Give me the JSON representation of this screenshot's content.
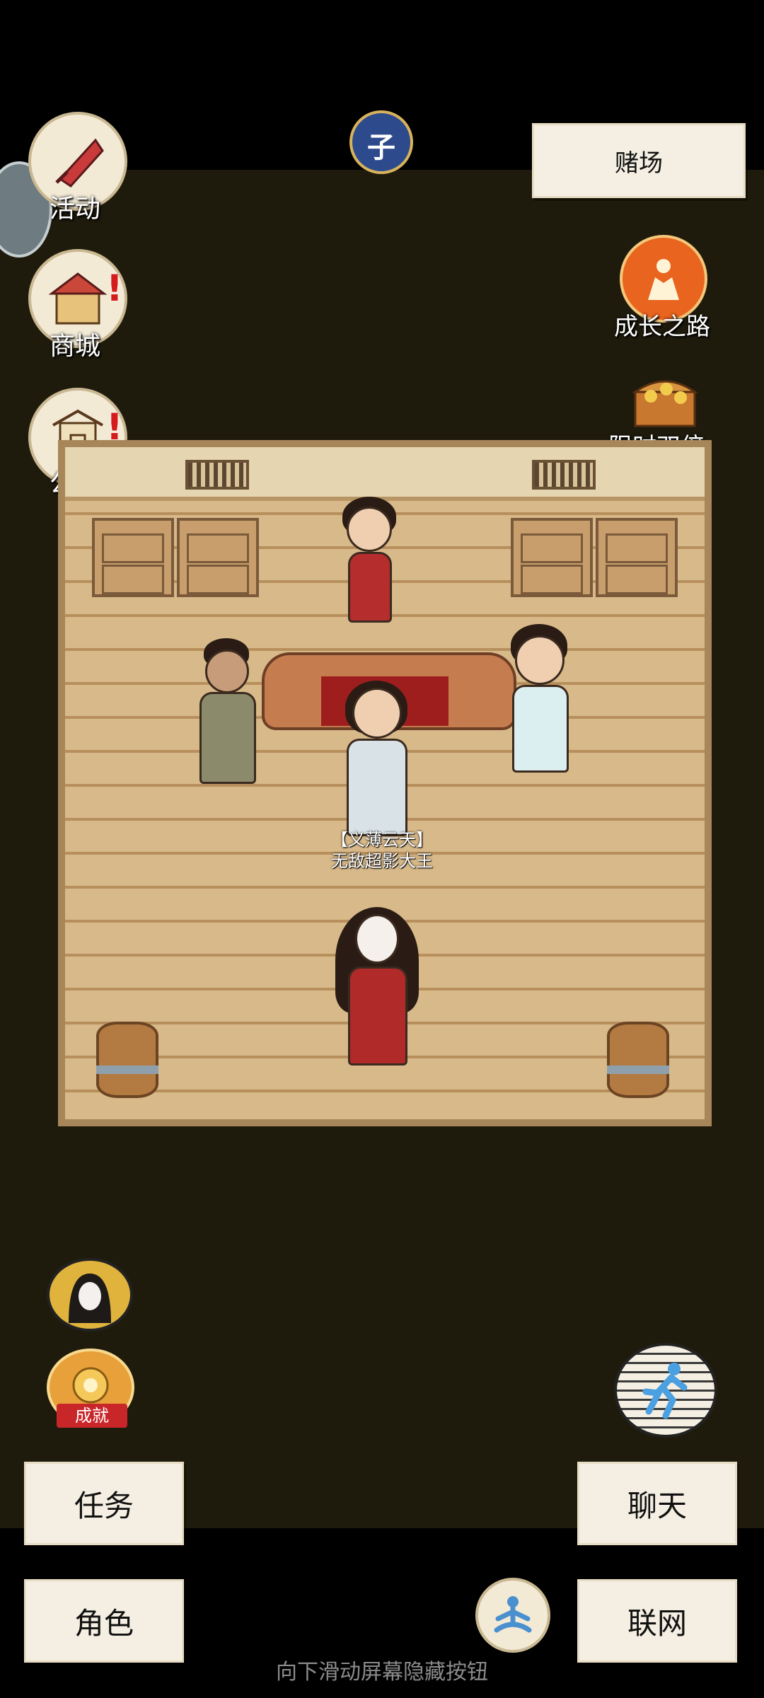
{
  "top": {
    "clock_glyph": "子",
    "casino_button": "赌场"
  },
  "left_menu": [
    {
      "label": "活动",
      "icon": "flag-icon"
    },
    {
      "label": "商城",
      "icon": "shop-icon"
    },
    {
      "label": "公告",
      "icon": "notice-icon"
    }
  ],
  "right_menu": [
    {
      "label": "成长之路",
      "icon": "growth-icon"
    },
    {
      "label": "限时双倍",
      "icon": "treasure-chest-icon"
    }
  ],
  "npc": {
    "name_line1": "【义薄云天】",
    "name_line2": "无敌超影大王"
  },
  "achievement": {
    "label": "成就"
  },
  "buttons": {
    "task": "任务",
    "chat": "聊天",
    "role": "角色",
    "network": "联网"
  },
  "hint": "向下滑动屏幕隐藏按钮",
  "colors": {
    "background": "#1f1b0c",
    "paper": "#f4efe2",
    "badge": "#d41c1c"
  }
}
